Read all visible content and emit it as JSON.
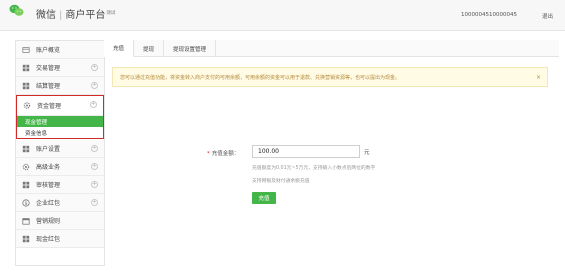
{
  "header": {
    "brand_name": "微信",
    "separator": "|",
    "product_name": "商户平台",
    "beta_badge": "测试",
    "account": "1000004510000045",
    "logout_label": "退出",
    "logo_icon": "wechat-logo-icon"
  },
  "sidebar": {
    "items_top": [
      {
        "label": "账户概览",
        "icon": "home-icon",
        "expandable": false
      },
      {
        "label": "交易管理",
        "icon": "grid-icon",
        "expandable": true
      },
      {
        "label": "结算管理",
        "icon": "grid-icon",
        "expandable": true
      }
    ],
    "group": {
      "label": "资金管理",
      "icon": "gear-icon",
      "expandable": true,
      "sub_items": [
        {
          "label": "现金管理",
          "active": true
        },
        {
          "label": "资金信息",
          "active": false
        }
      ]
    },
    "items_bottom": [
      {
        "label": "账户设置",
        "icon": "grid-icon",
        "expandable": true
      },
      {
        "label": "高级业务",
        "icon": "gear-icon",
        "expandable": true
      },
      {
        "label": "审核管理",
        "icon": "grid-icon",
        "expandable": true
      },
      {
        "label": "企业红包",
        "icon": "dollar-icon",
        "expandable": true
      },
      {
        "label": "营销规则",
        "icon": "calendar-icon",
        "expandable": false
      },
      {
        "label": "现金红包",
        "icon": "grid-icon",
        "expandable": false
      }
    ]
  },
  "main": {
    "tabs": [
      {
        "label": "充值",
        "active": true
      },
      {
        "label": "提现",
        "active": false
      },
      {
        "label": "提现设置管理",
        "active": false
      }
    ],
    "notice": {
      "text": "您可以通过充值功能，将资金转入商户支付的可用余额，可用余额的资金可以用于退款、兑换营销资源等，也可以提出为现金。",
      "close_label": "×"
    },
    "form": {
      "amount_label": "充值金额：",
      "required_mark": "*",
      "amount_value": "100.00",
      "unit": "元",
      "hint_range": "充值额度为0.01元~5万元，支持输入小数点后两位的数字",
      "hint_method": "支持网银及财付通余额充值",
      "submit_label": "充值"
    }
  },
  "colors": {
    "accent_green": "#44b549",
    "highlight_red": "#d02a2a",
    "notice_bg": "#fffbe5",
    "notice_text": "#b58a3b"
  }
}
